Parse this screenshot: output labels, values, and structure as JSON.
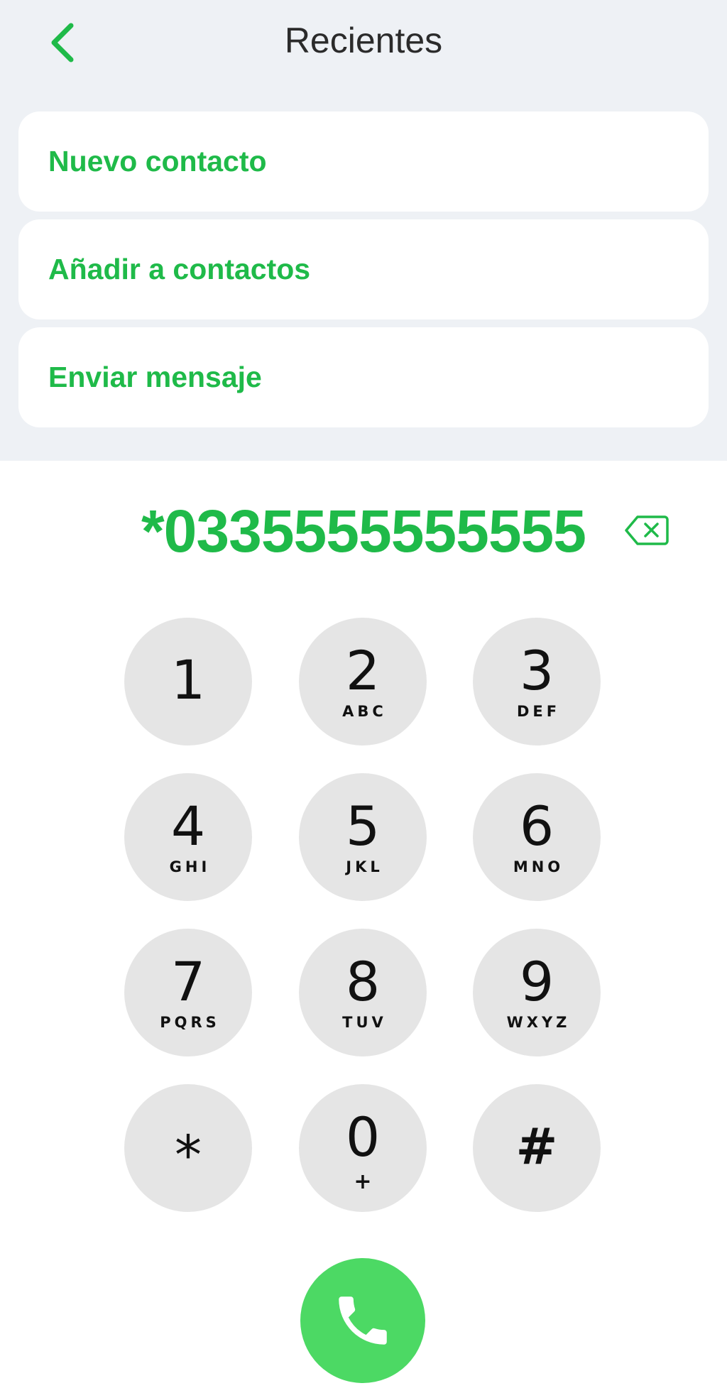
{
  "header": {
    "title": "Recientes",
    "back_icon": "chevron-left-icon"
  },
  "actions": [
    {
      "label": "Nuevo contacto"
    },
    {
      "label": "Añadir a contactos"
    },
    {
      "label": "Enviar mensaje"
    }
  ],
  "dialer": {
    "number": "*0335555555555",
    "backspace_icon": "backspace-icon",
    "keys": [
      {
        "digit": "1",
        "letters": ""
      },
      {
        "digit": "2",
        "letters": "ABC"
      },
      {
        "digit": "3",
        "letters": "DEF"
      },
      {
        "digit": "4",
        "letters": "GHI"
      },
      {
        "digit": "5",
        "letters": "JKL"
      },
      {
        "digit": "6",
        "letters": "MNO"
      },
      {
        "digit": "7",
        "letters": "PQRS"
      },
      {
        "digit": "8",
        "letters": "TUV"
      },
      {
        "digit": "9",
        "letters": "WXYZ"
      },
      {
        "digit": "*",
        "letters": ""
      },
      {
        "digit": "0",
        "letters": "+"
      },
      {
        "digit": "#",
        "letters": ""
      }
    ],
    "call_icon": "phone-icon"
  },
  "colors": {
    "accent": "#1fba49",
    "call_button": "#4cd964",
    "key_background": "#e5e5e5",
    "top_background": "#eef1f5"
  }
}
